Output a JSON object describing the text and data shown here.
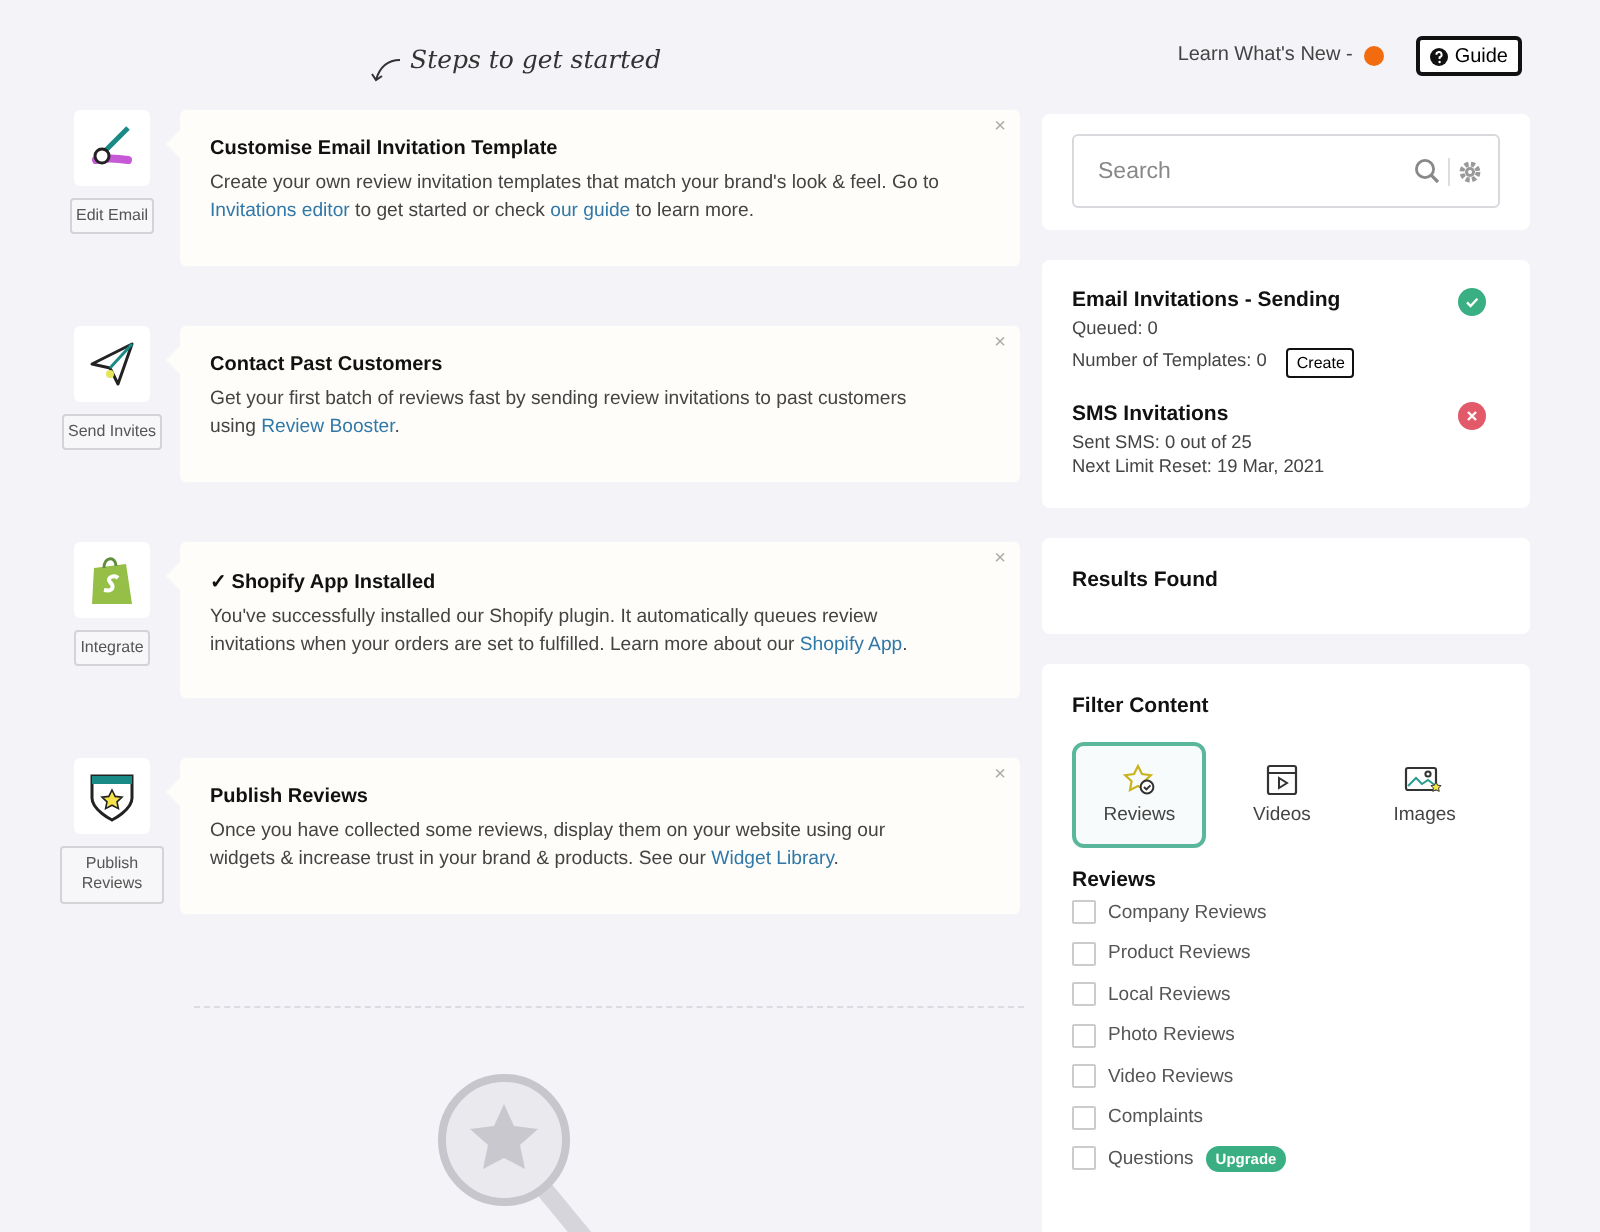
{
  "header": {
    "steps_caption": "Steps to get started",
    "whats_new": {
      "label": "Learn What's New -",
      "unread": true
    },
    "guide_button": {
      "label": "Guide"
    }
  },
  "steps": [
    {
      "kind": "brush",
      "button": "Edit Email",
      "title": "Customise Email Invitation Template",
      "close": "×",
      "body": [
        {
          "kind": "text",
          "text": "Create your own review invitation templates that match your brand's look & feel. Go to "
        },
        {
          "kind": "link",
          "text": "Invitations editor"
        },
        {
          "kind": "text",
          "text": " to get started or check "
        },
        {
          "kind": "link",
          "text": "our guide"
        },
        {
          "kind": "text",
          "text": " to learn more."
        }
      ]
    },
    {
      "kind": "plane",
      "button": "Send Invites",
      "title": "Contact Past Customers",
      "close": "×",
      "body": [
        {
          "kind": "text",
          "text": "Get your first batch of reviews fast by sending review invitations to past customers using "
        },
        {
          "kind": "link",
          "text": "Review Booster"
        },
        {
          "kind": "text",
          "text": "."
        }
      ]
    },
    {
      "kind": "bag",
      "button": "Integrate",
      "title": "✓ Shopify App Installed",
      "close": "×",
      "body": [
        {
          "kind": "text",
          "text": "You've successfully installed our Shopify plugin. It automatically queues review invitations when your orders are set to fulfilled. Learn more about our "
        },
        {
          "kind": "link",
          "text": "Shopify App"
        },
        {
          "kind": "text",
          "text": "."
        }
      ]
    },
    {
      "kind": "shield",
      "button": "Publish Reviews",
      "title": "Publish Reviews",
      "close": "×",
      "body": [
        {
          "kind": "text",
          "text": "Once you have collected some reviews, display them on your website using our widgets & increase trust in your brand & products. See our "
        },
        {
          "kind": "link",
          "text": "Widget Library"
        },
        {
          "kind": "text",
          "text": "."
        }
      ]
    }
  ],
  "search": {
    "placeholder": "Search"
  },
  "invitations": [
    {
      "kind": "ok",
      "title": "Email Invitations - Sending",
      "lines": [
        "Queued: 0",
        "Number of Templates: 0"
      ],
      "button": "Create"
    },
    {
      "kind": "error",
      "title": "SMS Invitations",
      "lines": [
        "Sent SMS: 0 out of 25",
        "Next Limit Reset: 19 Mar, 2021"
      ]
    }
  ],
  "results": {
    "title": "Results Found"
  },
  "filter": {
    "title": "Filter Content",
    "tabs": [
      {
        "kind": "reviews",
        "label": "Reviews",
        "selected": true
      },
      {
        "kind": "videos",
        "label": "Videos",
        "selected": false
      },
      {
        "kind": "images",
        "label": "Images",
        "selected": false
      }
    ],
    "section": "Reviews",
    "options": [
      {
        "label": "Company Reviews",
        "checked": false
      },
      {
        "label": "Product Reviews",
        "checked": false
      },
      {
        "label": "Local Reviews",
        "checked": false
      },
      {
        "label": "Photo Reviews",
        "checked": false
      },
      {
        "label": "Video Reviews",
        "checked": false
      },
      {
        "label": "Complaints",
        "checked": false
      },
      {
        "label": "Questions",
        "checked": false,
        "badge": "Upgrade"
      }
    ]
  }
}
